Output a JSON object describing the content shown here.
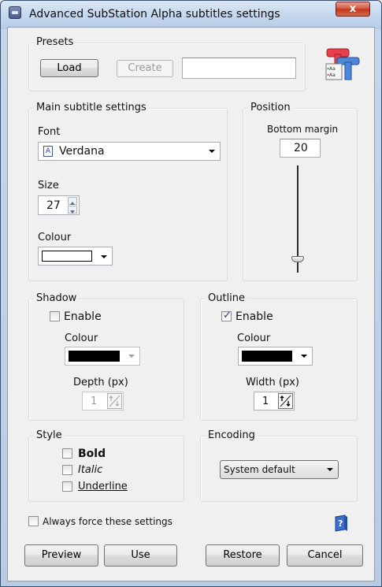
{
  "window": {
    "title": "Advanced SubStation Alpha subtitles settings",
    "close_glyph": "x"
  },
  "presets": {
    "title": "Presets",
    "load_label": "Load",
    "create_label": "Create",
    "name_value": ""
  },
  "main": {
    "title": "Main subtitle settings",
    "font_label": "Font",
    "font_value": "Verdana",
    "size_label": "Size",
    "size_value": "27",
    "colour_label": "Colour",
    "colour_value": "#ffffff"
  },
  "position": {
    "title": "Position",
    "bottom_margin_label": "Bottom margin",
    "bottom_margin_value": "20",
    "slider_level_fraction": 0.0
  },
  "shadow": {
    "title": "Shadow",
    "enable_label": "Enable",
    "enabled": false,
    "colour_label": "Colour",
    "colour_value": "#000000",
    "depth_label": "Depth (px)",
    "depth_value": "1"
  },
  "outline": {
    "title": "Outline",
    "enable_label": "Enable",
    "enabled": true,
    "colour_label": "Colour",
    "colour_value": "#000000",
    "width_label": "Width (px)",
    "width_value": "1"
  },
  "style": {
    "title": "Style",
    "bold_label": "Bold",
    "italic_label": "Italic",
    "underline_label": "Underline"
  },
  "encoding": {
    "title": "Encoding",
    "value": "System default"
  },
  "footer": {
    "force_label": "Always force these settings",
    "preview_label": "Preview",
    "use_label": "Use",
    "restore_label": "Restore",
    "cancel_label": "Cancel"
  },
  "icons": {
    "app": "subtitle-settings-icon",
    "presets": "font-tt-icon",
    "font_type": "font-file-icon",
    "help": "help-book-icon"
  }
}
